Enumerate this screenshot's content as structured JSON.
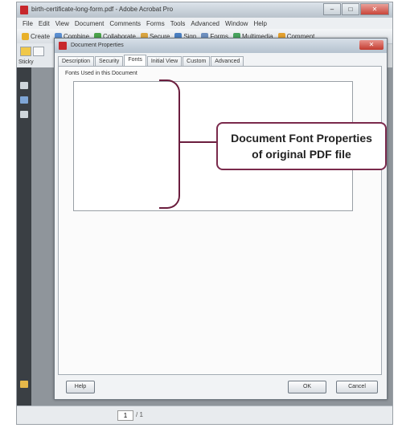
{
  "window": {
    "title": "birth-certificate-long-form.pdf - Adobe Acrobat Pro",
    "controls": [
      "–",
      "□",
      "✕"
    ]
  },
  "menu": [
    "File",
    "Edit",
    "View",
    "Document",
    "Comments",
    "Forms",
    "Tools",
    "Advanced",
    "Window",
    "Help"
  ],
  "toolbar": [
    {
      "label": "Create",
      "icon": "create-icon",
      "color": "#e8b02a"
    },
    {
      "label": "Combine",
      "icon": "combine-icon",
      "color": "#5b8fd1"
    },
    {
      "label": "Collaborate",
      "icon": "collaborate-icon",
      "color": "#4aa34a"
    },
    {
      "label": "Secure",
      "icon": "lock-icon",
      "color": "#d9a441"
    },
    {
      "label": "Sign",
      "icon": "pen-icon",
      "color": "#4a7fc1"
    },
    {
      "label": "Forms",
      "icon": "forms-icon",
      "color": "#6d8fbf"
    },
    {
      "label": "Multimedia",
      "icon": "multimedia-icon",
      "color": "#47a35e"
    },
    {
      "label": "Comment",
      "icon": "comment-icon",
      "color": "#e2a030"
    }
  ],
  "sidebar": {
    "sticky_label": "Sticky"
  },
  "status": {
    "page": "1",
    "page_total": "/ 1"
  },
  "dialog": {
    "title": "Document Properties",
    "tabs": [
      "Description",
      "Security",
      "Fonts",
      "Initial View",
      "Custom",
      "Advanced"
    ],
    "active_tab": "Fonts",
    "fonts_label": "Fonts Used in this Document",
    "help_button": "Help",
    "ok_button": "OK",
    "cancel_button": "Cancel"
  },
  "annotation": {
    "line1": "Document Font Properties",
    "line2": "of original PDF file",
    "color": "#6b1e3e"
  }
}
